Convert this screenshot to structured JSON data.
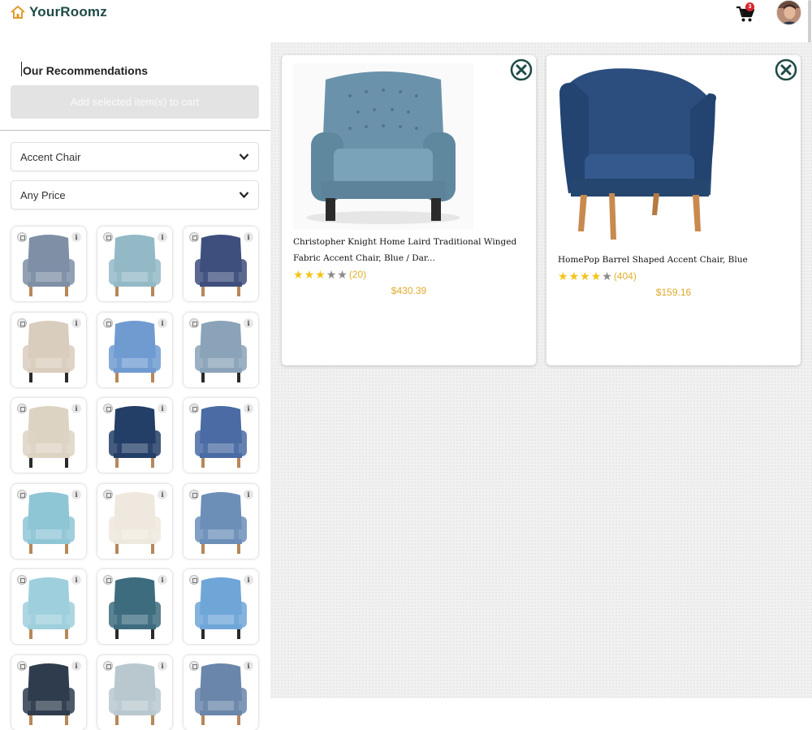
{
  "app": {
    "logo_text": "YourRoomz",
    "cart_count": "3"
  },
  "sidebar": {
    "title": "Our Recommendations",
    "add_button_label": "Add selected item(s) to cart",
    "category_select": "Accent Chair",
    "price_select": "Any Price",
    "info_symbol": "i",
    "tiles": [
      {
        "name": "striped-wingback-chair",
        "color": "#7e8fa6"
      },
      {
        "name": "light-blue-tufted-chair",
        "color": "#93b9c7"
      },
      {
        "name": "floral-blue-chair",
        "color": "#3e4f7d"
      },
      {
        "name": "beige-tufted-wingback",
        "color": "#d9cdbd"
      },
      {
        "name": "blue-channel-back-chair",
        "color": "#6f9bd1"
      },
      {
        "name": "blue-dining-chairs-pair",
        "color": "#8aa3b8"
      },
      {
        "name": "beige-recliner",
        "color": "#ddd3c3"
      },
      {
        "name": "navy-barrel-chair",
        "color": "#233e67"
      },
      {
        "name": "floral-slipper-chair",
        "color": "#4a6ba3"
      },
      {
        "name": "aqua-club-chair",
        "color": "#8fc6d6"
      },
      {
        "name": "white-wood-chairs-pair",
        "color": "#efe8de"
      },
      {
        "name": "blue-mid-century-chair",
        "color": "#6c8fb8"
      },
      {
        "name": "blue-scallop-chair-room",
        "color": "#9ecfdc"
      },
      {
        "name": "teal-tufted-wingback",
        "color": "#3d6c7f"
      },
      {
        "name": "sky-blue-wingback",
        "color": "#6fa6d8"
      },
      {
        "name": "blue-velvet-chair-room",
        "color": "#2f3c4d"
      },
      {
        "name": "floral-chairs-pair",
        "color": "#b9c8cf"
      },
      {
        "name": "slate-tufted-swivel",
        "color": "#6a86aa"
      }
    ]
  },
  "comparison": {
    "items": [
      {
        "title": "Christopher Knight Home Laird Traditional Winged Fabric Accent Chair, Blue / Dar...",
        "rating": 3,
        "review_count": "(20)",
        "price": "$430.39",
        "color": "#6a93ab"
      },
      {
        "title": "HomePop Barrel Shaped Accent Chair, Blue",
        "rating": 4,
        "review_count": "(404)",
        "price": "$159.16",
        "color": "#2c4e7e"
      }
    ]
  },
  "colors": {
    "brand": "#1f4b47",
    "price": "#e0a92a",
    "star": "#f2c417",
    "badge": "#d8262f"
  }
}
